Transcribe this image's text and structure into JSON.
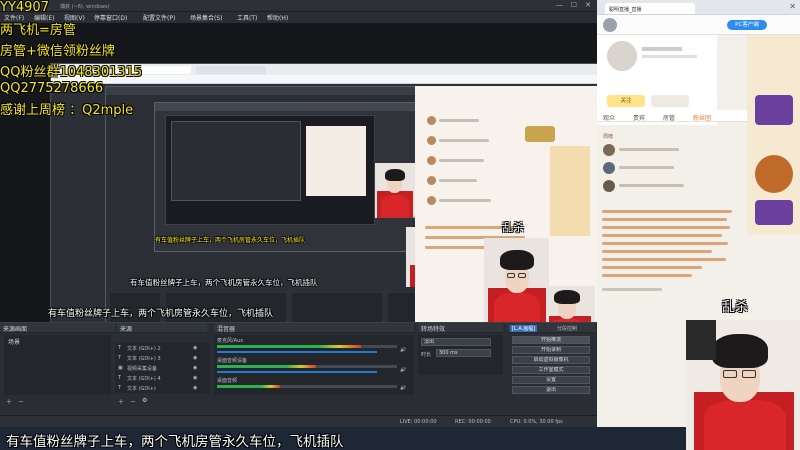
{
  "obs": {
    "titlebar_text": "捕获 (~6), windows)",
    "menu": [
      "文件(F)",
      "编辑(E)",
      "视图(V)",
      "停靠窗口(D)",
      "配置文件(P)",
      "场景集合(S)",
      "工具(T)",
      "帮助(H)"
    ],
    "docks": {
      "scenes_title": "来源画面",
      "scene_item": "场景",
      "sources_title": "来源",
      "sources": [
        {
          "label": "文本 (GDI+) 2"
        },
        {
          "label": "文本 (GDI+) 3"
        },
        {
          "label": "视频采集设备"
        },
        {
          "label": "文本 (GDI+) 4"
        },
        {
          "label": "文本 (GDI+)"
        }
      ],
      "mixer_title": "混音器",
      "mixer": [
        {
          "name": "麦克风/Aux",
          "level": 0.8
        },
        {
          "name": "桌面音频设备",
          "level": 0.55
        },
        {
          "name": "桌面音频",
          "level": 0.35
        }
      ],
      "transitions_title": "转场特效",
      "transition_value": "淡出",
      "duration_label": "时长",
      "duration_value": "300 ms",
      "controls_title": "控件",
      "controls": [
        "开始推流",
        "开始录制",
        "启动虚拟摄像机",
        "工作室模式",
        "设置",
        "退出"
      ],
      "live_tab": "[L.A.画幅]",
      "extra_tab": "分段控制"
    },
    "status": {
      "live": "LIVE: 00:00:00",
      "rec": "REC: 00:00:00",
      "cpu": "CPU: 0.0%, 30.00 fps"
    }
  },
  "overlay": {
    "lines": [
      "YY4907",
      "两飞机=房管",
      "房管+微信领粉丝牌",
      "QQ粉丝群1048301315",
      "QQ2775278666",
      "感谢上周榜 ：Q2mple"
    ],
    "caption_inner_small": "有车值粉丝牌子上车，两个飞机房管永久车位，飞机插队",
    "caption_mid": "有车值粉丝牌子上车，两个飞机房管永久车位，飞机插队",
    "caption_bottom": "有车值粉丝牌子上车，两个飞机房管永久车位，飞机插队",
    "cam_label_inner_small": "乱杀",
    "cam_label_inner_mid": "乱杀",
    "cam_label_right": "乱杀"
  },
  "live_page": {
    "tab_title": "聪明直播_直播",
    "header_btn": "PC客户端",
    "follow_btn": "关注",
    "tabs": [
      "观众",
      "贵宾",
      "房管",
      "粉丝团"
    ],
    "rank_title": "周榜"
  },
  "colors": {
    "accent": "#f6e71e",
    "live_red": "#d8262b",
    "obs_bg": "#2a2d33"
  }
}
